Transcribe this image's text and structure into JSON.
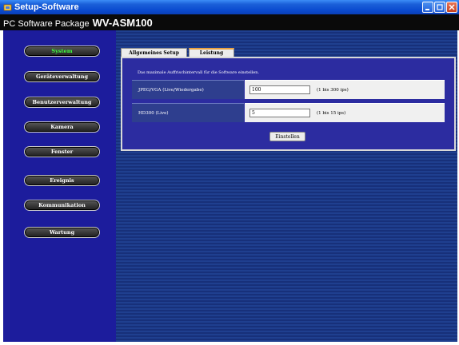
{
  "window": {
    "title": "Setup-Software"
  },
  "header": {
    "package_label": "PC Software Package",
    "product": "WV-ASM100"
  },
  "sidebar": {
    "items": [
      {
        "label": "System",
        "active": true
      },
      {
        "label": "Geräteverwaltung"
      },
      {
        "label": "Benutzerverwaltung"
      },
      {
        "label": "Kamera"
      },
      {
        "label": "Fenster"
      },
      {
        "label": "Ereignis"
      },
      {
        "label": "Kommunikation"
      },
      {
        "label": "Wartung"
      }
    ]
  },
  "tabs": [
    {
      "label": "Allgemeines Setup"
    },
    {
      "label": "Leistung",
      "selected": true
    }
  ],
  "panel": {
    "description": "Das maximale Auffrischintervall für die Software einstellen.",
    "rows": [
      {
        "label": "JPEG/VGA (Live/Wiedergabe)",
        "value": "100",
        "hint": "(1 bis 300 ips)"
      },
      {
        "label": "HD300 (Live)",
        "value": "5",
        "hint": "(1 bis 15 ips)"
      }
    ],
    "submit_label": "Einstellen"
  },
  "colors": {
    "sidebar_bg": "#1c1c9c",
    "active_nav_text": "#3fff3f",
    "panel_bg": "#2c2ca0"
  }
}
